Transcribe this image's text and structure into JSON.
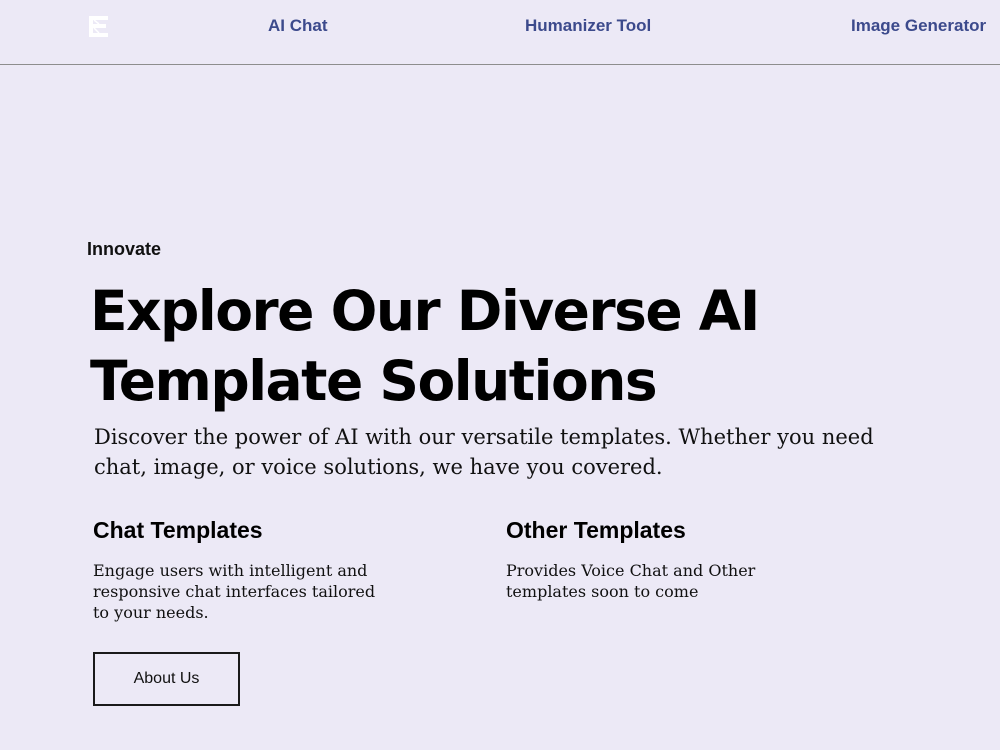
{
  "header": {
    "logo_icon": "stacked-e-logo-icon",
    "nav": [
      {
        "label": "AI Chat"
      },
      {
        "label": "Humanizer Tool"
      },
      {
        "label": "Image Generator"
      }
    ]
  },
  "hero": {
    "eyebrow": "Innovate",
    "headline": "Explore Our Diverse AI Template Solutions",
    "intro": "Discover the power of AI with our versatile templates. Whether you need chat, image, or voice solutions, we have you covered."
  },
  "features": [
    {
      "title": "Chat Templates",
      "description": "Engage users with intelligent and responsive chat interfaces tailored to your needs."
    },
    {
      "title": "Other Templates",
      "description": "Provides Voice Chat and Other templates soon to come"
    }
  ],
  "cta": {
    "about_label": "About Us"
  },
  "colors": {
    "background": "#ece9f6",
    "nav_link": "#3c4a8c",
    "text": "#000000"
  }
}
